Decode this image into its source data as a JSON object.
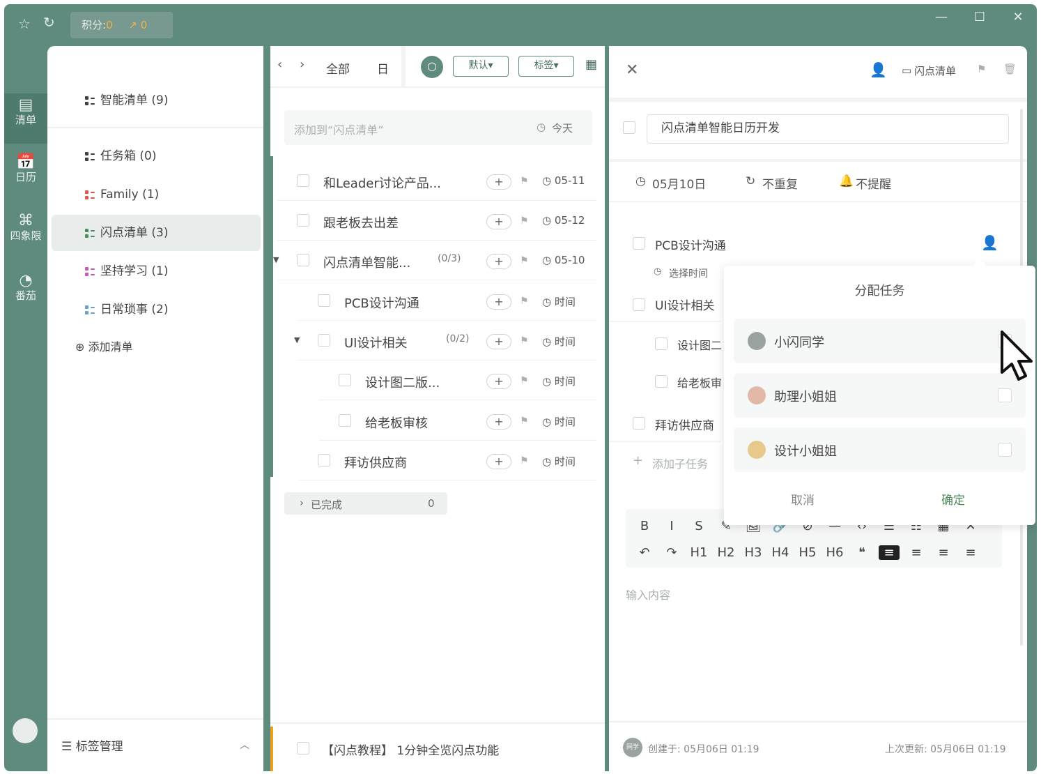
{
  "topbar": {
    "score_label": "积分:",
    "score_value": "0",
    "trend_value": "0",
    "icons": [
      "pin-icon",
      "refresh-icon",
      "trend-icon"
    ],
    "window_controls": [
      "minimize",
      "maximize",
      "close"
    ]
  },
  "rail": {
    "items": [
      {
        "label": "清单",
        "icon": "list-icon",
        "active": true
      },
      {
        "label": "日历",
        "icon": "calendar-icon"
      },
      {
        "label": "四象限",
        "icon": "quadrant-icon"
      },
      {
        "label": "番茄",
        "icon": "tomato-icon"
      }
    ]
  },
  "sidebar": {
    "lists": [
      {
        "label": "智能清单 (9)",
        "color": "#3e3e3e"
      },
      {
        "label": "任务箱 (0)",
        "color": "#3e3e3e"
      },
      {
        "label": "Family (1)",
        "color": "#e0564b"
      },
      {
        "label": "闪点清单 (3)",
        "color": "#4f8a5c",
        "selected": true
      },
      {
        "label": "坚持学习 (1)",
        "color": "#c45bb4"
      },
      {
        "label": "日常琐事 (2)",
        "color": "#6aa0c8"
      }
    ],
    "add_list": "添加清单",
    "tag_manage": "标签管理"
  },
  "middle": {
    "filter_all": "全部",
    "filter_day": "日",
    "sort_btn": "默认▾",
    "tag_btn": "标签▾",
    "add_placeholder": "添加到“闪点清单”",
    "add_today": "今天",
    "tasks": [
      {
        "title": "和Leader讨论产品...",
        "date": "05-11",
        "indent": 0
      },
      {
        "title": "跟老板去出差",
        "date": "05-12",
        "indent": 0
      },
      {
        "title": "闪点清单智能...",
        "sub": "(0/3)",
        "date": "05-10",
        "indent": 0,
        "expand": true
      },
      {
        "title": "PCB设计沟通",
        "date": "时间",
        "indent": 1
      },
      {
        "title": "UI设计相关",
        "sub": "(0/2)",
        "date": "时间",
        "indent": 1,
        "expand": true
      },
      {
        "title": "设计图二版...",
        "date": "时间",
        "indent": 2
      },
      {
        "title": "给老板审核",
        "date": "时间",
        "indent": 2
      },
      {
        "title": "拜访供应商",
        "date": "时间",
        "indent": 1
      }
    ],
    "completed_label": "已完成",
    "completed_count": "0",
    "tutorial": "【闪点教程】 1分钟全览闪点功能"
  },
  "detail": {
    "list_name": "闪点清单",
    "title": "闪点清单智能日历开发",
    "date": "05月10日",
    "repeat": "不重复",
    "remind": "不提醒",
    "subtasks": [
      {
        "title": "PCB设计沟通"
      },
      {
        "title": "UI设计相关"
      },
      {
        "title": "设计图二"
      },
      {
        "title": "给老板审"
      },
      {
        "title": "拜访供应商"
      }
    ],
    "choose_time": "选择时间",
    "add_subtask": "添加子任务",
    "editor_placeholder": "输入内容",
    "created": "创建于: 05月06日 01:19",
    "updated": "上次更新: 05月06日 01:19",
    "avatar_text": "同学"
  },
  "popup": {
    "title": "分配任务",
    "members": [
      {
        "name": "小闪同学",
        "color": "#9aa3a0"
      },
      {
        "name": "助理小姐姐",
        "color": "#e2b8a8"
      },
      {
        "name": "设计小姐姐",
        "color": "#e8c98c"
      }
    ],
    "cancel": "取消",
    "confirm": "确定"
  },
  "editor_toolbar": {
    "row1": [
      "B",
      "I",
      "S",
      "✎",
      "🖼",
      "🔗",
      "⊘",
      "—",
      "‹›",
      "☰",
      "☷",
      "▦",
      "✕"
    ],
    "row2": [
      "↶",
      "↷",
      "H1",
      "H2",
      "H3",
      "H4",
      "H5",
      "H6",
      "❝",
      "≡",
      "≡",
      "≡",
      "≡"
    ]
  }
}
